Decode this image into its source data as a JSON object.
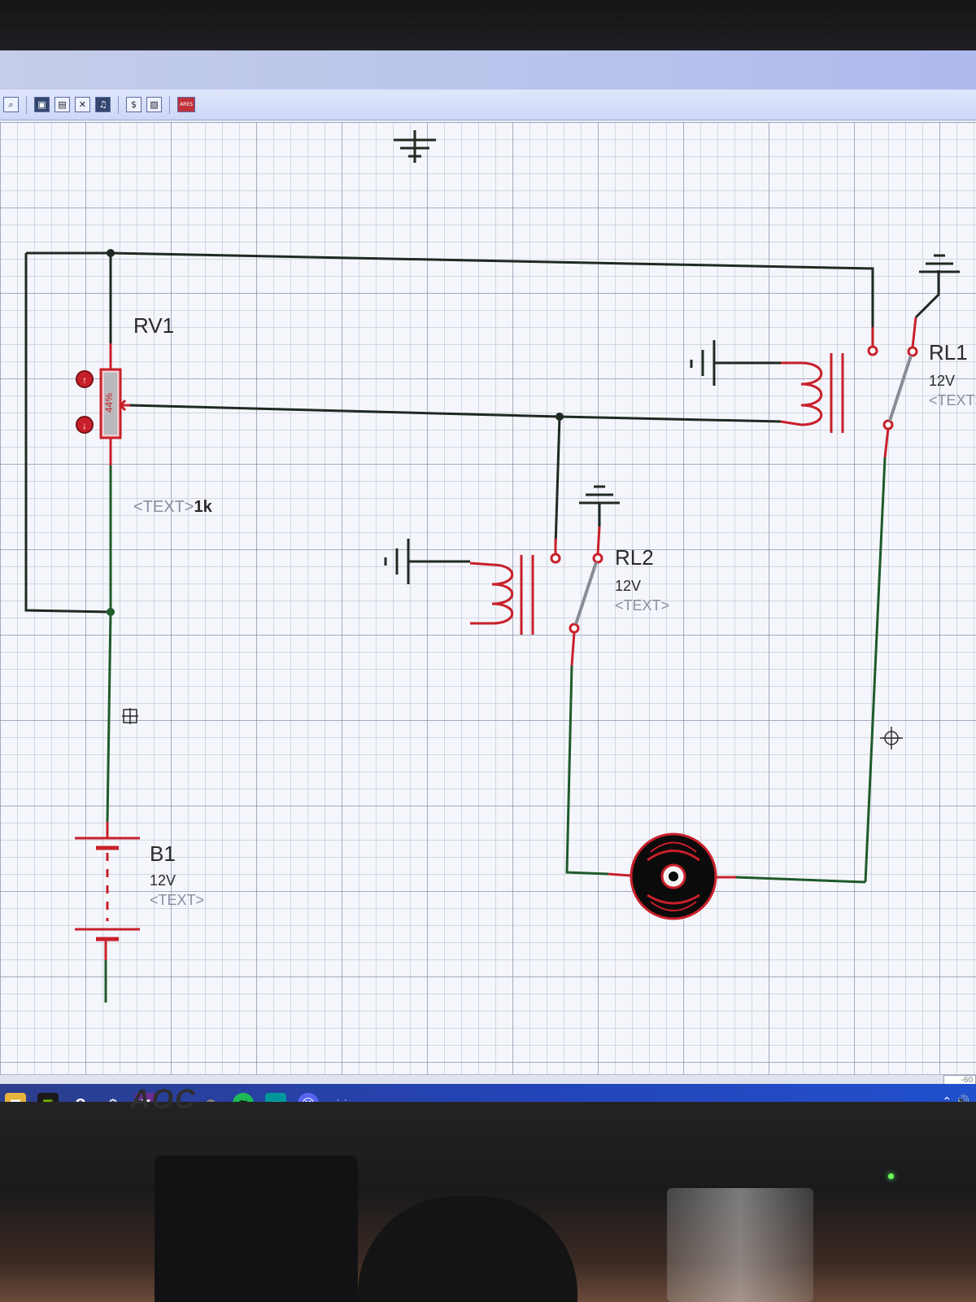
{
  "toolbar": {
    "buttons": [
      {
        "icon": "zoom-icon",
        "glyph": "⌕"
      },
      {
        "icon": "block-copy-icon",
        "glyph": "▣"
      },
      {
        "icon": "block-move-icon",
        "glyph": "▤"
      },
      {
        "icon": "block-delete-icon",
        "glyph": "✕"
      },
      {
        "icon": "pick-device-icon",
        "glyph": "♫"
      },
      {
        "icon": "make-device-icon",
        "glyph": "$"
      },
      {
        "icon": "decompose-icon",
        "glyph": "▧"
      },
      {
        "icon": "ares-icon",
        "glyph": "ARES"
      }
    ]
  },
  "components": {
    "rv1": {
      "ref": "RV1",
      "value_text": "<TEXT>",
      "value": "1k",
      "wiper_percent": "44%"
    },
    "rl1": {
      "ref": "RL1",
      "voltage": "12V",
      "text": "<TEXT>"
    },
    "rl2": {
      "ref": "RL2",
      "voltage": "12V",
      "text": "<TEXT>"
    },
    "b1": {
      "ref": "B1",
      "voltage": "12V",
      "text": "<TEXT>"
    }
  },
  "colors": {
    "wire_black": "#1e2a22",
    "wire_green": "#1f5a2a",
    "pin_red": "#c8202a",
    "motor_body": "#0b0b0b"
  },
  "taskbar": {
    "apps": [
      {
        "name": "file-explorer-icon",
        "glyph": "▆"
      },
      {
        "name": "nvidia-icon",
        "glyph": "◩"
      },
      {
        "name": "opera-icon",
        "glyph": "O"
      },
      {
        "name": "steam-icon",
        "glyph": "⚙"
      },
      {
        "name": "visual-studio-icon",
        "glyph": "▼"
      },
      {
        "name": "airplane-icon",
        "glyph": "✈"
      },
      {
        "name": "chrome-icon",
        "glyph": "◉"
      },
      {
        "name": "spotify-icon",
        "glyph": "≋"
      },
      {
        "name": "arduino-icon",
        "glyph": "∞"
      },
      {
        "name": "discord-icon",
        "glyph": "☺"
      }
    ],
    "active_label": "isis",
    "tray": "⌃ 🔊"
  },
  "status": {
    "coord": "-60"
  },
  "monitor": {
    "brand": "AOC"
  }
}
